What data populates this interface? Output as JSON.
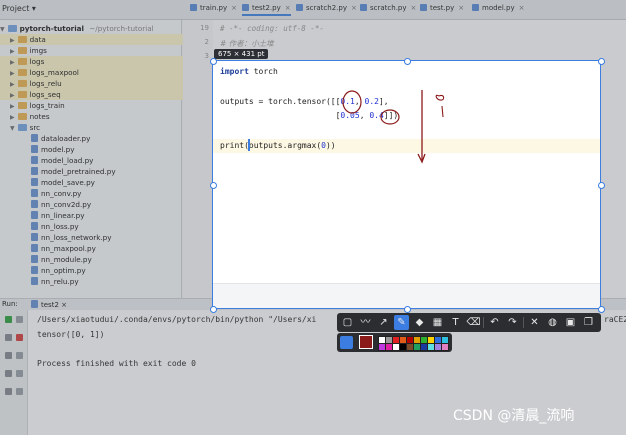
{
  "project_tab": "Project",
  "editor_tabs": [
    "train.py",
    "test2.py",
    "scratch2.py",
    "scratch.py",
    "test.py",
    "model.py"
  ],
  "tree": {
    "root": "pytorch-tutorial",
    "root_path": "~/pytorch-tutorial",
    "folders": [
      "data",
      "imgs",
      "logs",
      "logs_maxpool",
      "logs_relu",
      "logs_seq",
      "logs_train",
      "notes",
      "src"
    ],
    "files": [
      "dataloader.py",
      "model.py",
      "model_load.py",
      "model_pretrained.py",
      "model_save.py",
      "nn_conv.py",
      "nn_conv2d.py",
      "nn_linear.py",
      "nn_loss.py",
      "nn_loss_network.py",
      "nn_maxpool.py",
      "nn_module.py",
      "nn_optim.py",
      "nn_relu.py"
    ]
  },
  "editor_bg": {
    "line_numbers": [
      "19",
      "2",
      "3"
    ],
    "line1": "# -*- coding: utf-8 -*-",
    "line2": "# 作者：小土堆"
  },
  "selection": {
    "size_label": "675 × 431  pt",
    "code": {
      "l1_kw": "import",
      "l1_rest": " torch",
      "l2_pre": "outputs = torch.tensor([[",
      "l2_a": "0.1",
      "l2_sep": ", ",
      "l2_b": "0.2",
      "l2_end": "],",
      "l3_pre": "                        [",
      "l3_a": "0.05",
      "l3_sep": ", ",
      "l3_b": "0.4",
      "l3_end": "]])",
      "l4_pre": "print(outputs.argmax(",
      "l4_num": "0",
      "l4_end": "))"
    }
  },
  "run": {
    "label": "Run:",
    "config": "test2",
    "cmd": "/Users/xiaotudui/.conda/envs/pytorch/bin/python \"/Users/xi",
    "result": "tensor([0, 1])",
    "exit": "Process finished with exit code 0",
    "overflow": "raCE2"
  },
  "toolbar": {
    "icons": [
      "rect-icon",
      "pen-squiggle-icon",
      "arrow-icon",
      "pencil-icon",
      "marker-icon",
      "mosaic-icon",
      "text-icon",
      "eraser-icon",
      "undo-icon",
      "redo-icon",
      "close-icon",
      "pin-icon",
      "save-icon",
      "copy-icon"
    ],
    "glyphs": [
      "▢",
      "〰",
      "↗",
      "✎",
      "◆",
      "▦",
      "T",
      "⌫",
      "↶",
      "↷",
      "✕",
      "◍",
      "▣",
      "❐"
    ]
  },
  "palette": {
    "selected": "#8b1a1a",
    "colors": [
      "#ffffff",
      "#9a9a9a",
      "#e02020",
      "#e05a1a",
      "#b00000",
      "#e0a000",
      "#30b030",
      "#ffd200",
      "#2b6ee0",
      "#2ec0e0",
      "#c03ae0",
      "#e020a0",
      "#ffffff",
      "#000000",
      "#7a4a2a",
      "#20a060",
      "#1a3aa0",
      "#60e0e0",
      "#a080e0",
      "#e080c0"
    ]
  },
  "watermark": "CSDN @清晨_流响"
}
